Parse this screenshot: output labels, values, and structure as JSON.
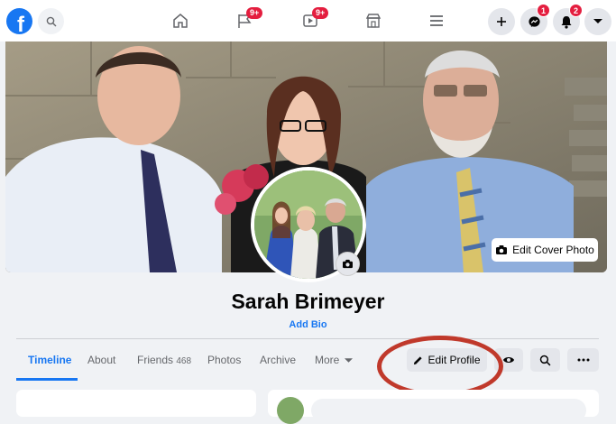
{
  "topbar": {
    "logo_letter": "f",
    "nav": [
      {
        "name": "home-icon"
      },
      {
        "name": "pages-flag-icon",
        "badge": "9+"
      },
      {
        "name": "watch-video-icon",
        "badge": "9+"
      },
      {
        "name": "marketplace-icon"
      },
      {
        "name": "menu-icon"
      }
    ],
    "right": [
      {
        "name": "create-plus-icon"
      },
      {
        "name": "messenger-icon",
        "badge": "1"
      },
      {
        "name": "notifications-bell-icon",
        "badge": "2"
      },
      {
        "name": "account-caret-icon"
      }
    ]
  },
  "cover": {
    "edit_label": "Edit Cover Photo"
  },
  "profile": {
    "name": "Sarah Brimeyer",
    "add_bio": "Add Bio"
  },
  "tabs": [
    {
      "label": "Timeline",
      "active": true
    },
    {
      "label": "About"
    },
    {
      "label": "Friends",
      "count": "468"
    },
    {
      "label": "Photos"
    },
    {
      "label": "Archive"
    },
    {
      "label": "More"
    }
  ],
  "actions": {
    "edit_profile": "Edit Profile",
    "view_icon": "eye-icon",
    "search_icon": "search-icon",
    "more_icon": "ellipsis-icon"
  },
  "colors": {
    "brand": "#1877f2",
    "badge": "#e41e3f",
    "highlight_circle": "#c0392b"
  }
}
